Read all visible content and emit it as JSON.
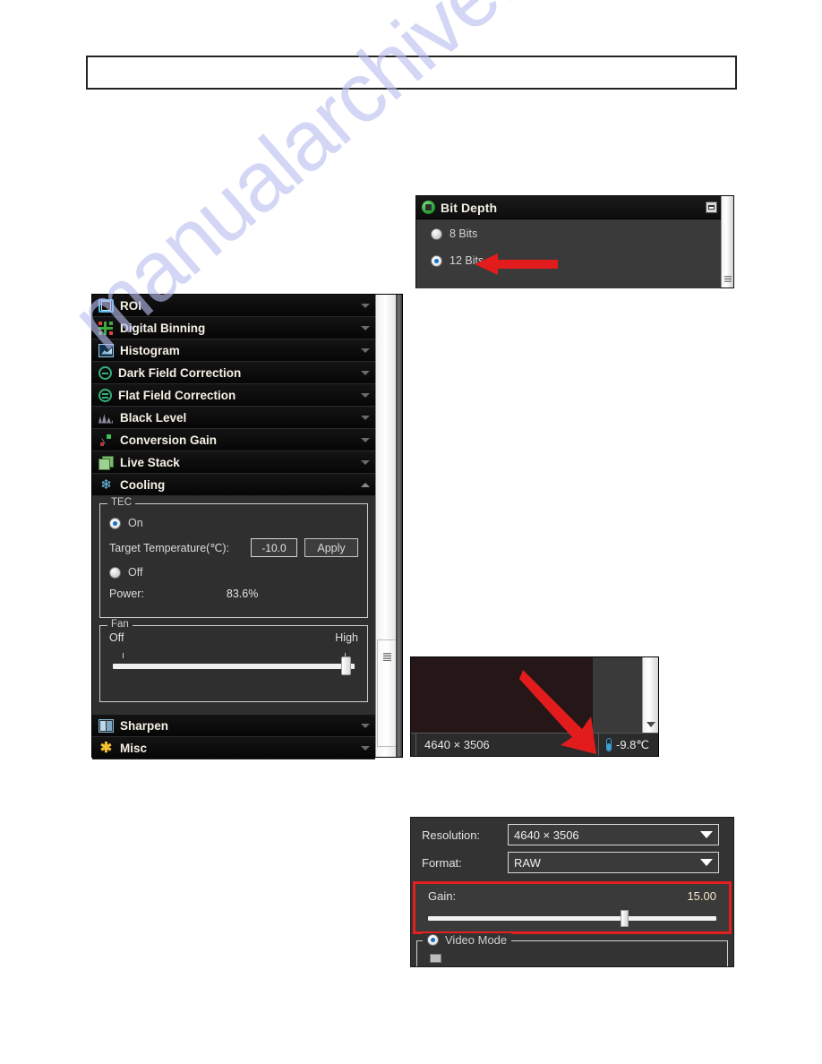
{
  "watermark": {
    "text": "manualarchive.com"
  },
  "bit_depth_panel": {
    "title": "Bit Depth",
    "icon": "green-circle-icon",
    "minimize_icon": "minimize-icon",
    "options": [
      {
        "label": "8 Bits",
        "selected": false
      },
      {
        "label": "12 Bits",
        "selected": true
      }
    ],
    "annotation_arrow": "red-arrow-pointing-left"
  },
  "left_panel": {
    "groups": [
      {
        "label": "ROI",
        "icon": "roi-icon",
        "expanded": false
      },
      {
        "label": "Digital Binning",
        "icon": "binning-icon",
        "expanded": false
      },
      {
        "label": "Histogram",
        "icon": "histogram-icon",
        "expanded": false
      },
      {
        "label": "Dark Field Correction",
        "icon": "circle-minus-icon",
        "expanded": false
      },
      {
        "label": "Flat Field Correction",
        "icon": "circle-equals-icon",
        "expanded": false
      },
      {
        "label": "Black Level",
        "icon": "waveform-icon",
        "expanded": false
      },
      {
        "label": "Conversion Gain",
        "icon": "conversion-gain-icon",
        "expanded": false
      },
      {
        "label": "Live Stack",
        "icon": "stack-icon",
        "expanded": false
      },
      {
        "label": "Cooling",
        "icon": "snowflake-icon",
        "expanded": true
      }
    ],
    "cooling": {
      "tec": {
        "legend": "TEC",
        "on_label": "On",
        "on_selected": true,
        "off_label": "Off",
        "off_selected": false,
        "target_temp_label": "Target Temperature(℃):",
        "target_temp_value": "-10.0",
        "apply_label": "Apply",
        "power_label": "Power:",
        "power_value": "83.6%"
      },
      "fan": {
        "legend": "Fan",
        "min_label": "Off",
        "max_label": "High",
        "slider_percent": 97
      }
    },
    "bottom_groups": [
      {
        "label": "Sharpen",
        "icon": "sharpen-icon",
        "expanded": false
      },
      {
        "label": "Misc",
        "icon": "asterisk-icon",
        "expanded": false
      }
    ]
  },
  "preview_panel": {
    "status_resolution": "4640 × 3506",
    "temperature_icon": "thermometer-icon",
    "temperature_value": "-9.8℃",
    "scroll_down_icon": "chevron-down-icon",
    "annotation_arrow": "red-arrow-pointing-down-right"
  },
  "settings_panel": {
    "resolution_label": "Resolution:",
    "resolution_value": "4640 × 3506",
    "format_label": "Format:",
    "format_value": "RAW",
    "gain_label": "Gain:",
    "gain_value": "15.00",
    "gain_slider_percent": 68,
    "video_mode_label": "Video Mode",
    "video_mode_selected": true,
    "highlight_color": "#e41f1f"
  }
}
